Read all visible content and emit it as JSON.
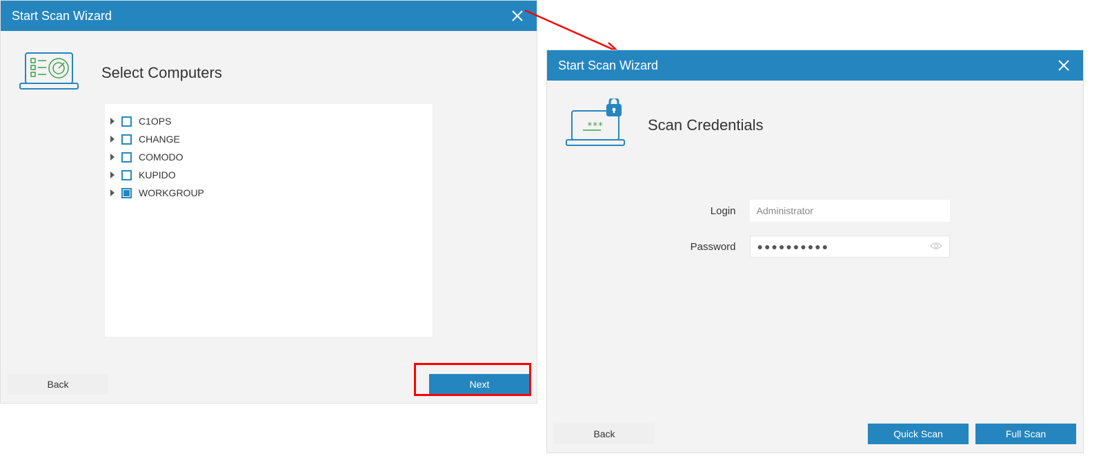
{
  "left_dialog": {
    "title": "Start Scan Wizard",
    "heading": "Select Computers",
    "tree": [
      {
        "label": "C1OPS",
        "checked": "empty"
      },
      {
        "label": "CHANGE",
        "checked": "empty"
      },
      {
        "label": "COMODO",
        "checked": "empty"
      },
      {
        "label": "KUPIDO",
        "checked": "empty"
      },
      {
        "label": "WORKGROUP",
        "checked": "indet"
      }
    ],
    "back_label": "Back",
    "next_label": "Next"
  },
  "right_dialog": {
    "title": "Start Scan Wizard",
    "heading": "Scan Credentials",
    "login_label": "Login",
    "login_placeholder": "Administrator",
    "password_label": "Password",
    "password_mask": "●●●●●●●●●●",
    "back_label": "Back",
    "quick_scan_label": "Quick Scan",
    "full_scan_label": "Full Scan"
  }
}
